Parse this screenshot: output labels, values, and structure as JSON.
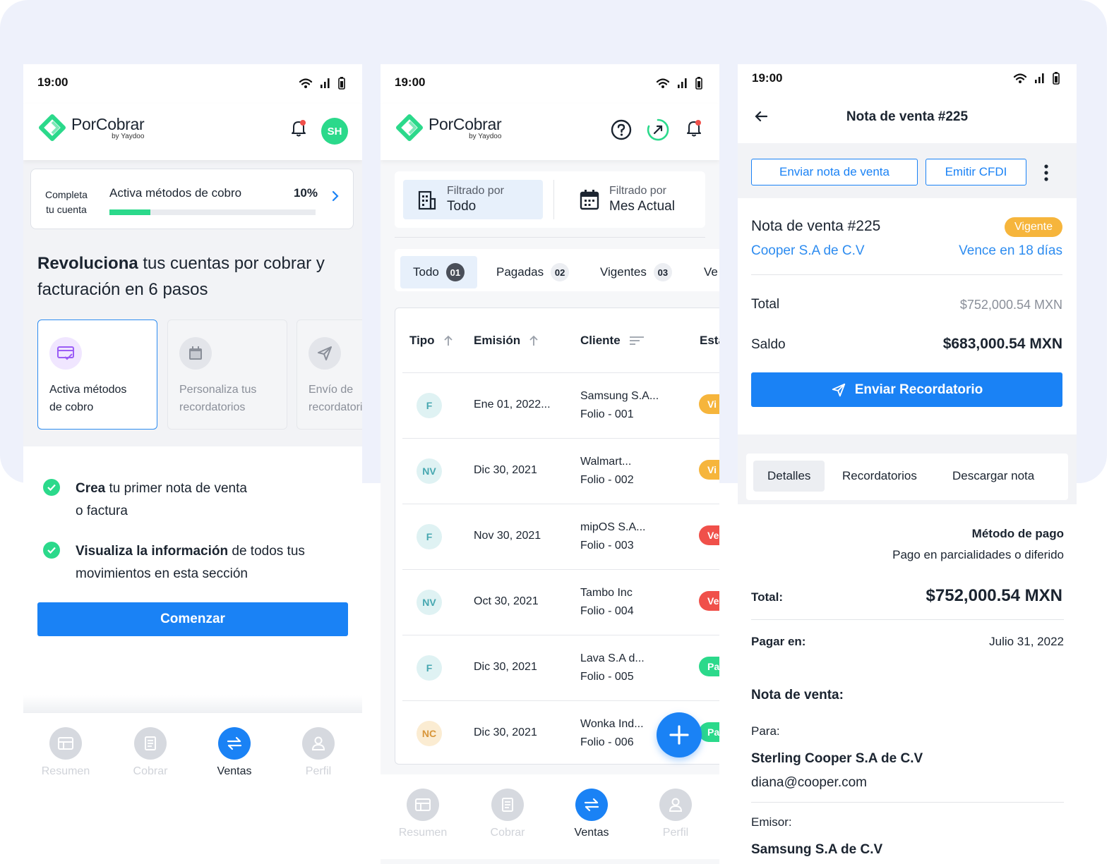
{
  "status": {
    "time": "19:00"
  },
  "brand": {
    "name": "PorCobrar",
    "by": "by Yaydoo"
  },
  "colors": {
    "primary": "#1a82f5",
    "green": "#2bd98b",
    "warning": "#f6b53c",
    "danger": "#f0504a"
  },
  "screen1": {
    "avatar": "SH",
    "progress": {
      "left_line1": "Completa",
      "left_line2": "tu cuenta",
      "title": "Activa métodos de cobro",
      "percent": "10%",
      "fraction": 0.2
    },
    "headline": {
      "bold": "Revoluciona",
      "rest": " tus cuentas por cobrar y facturación en 6 pasos"
    },
    "steps": [
      {
        "line1": "Activa métodos",
        "line2": "de cobro",
        "icon": "payment-card-icon"
      },
      {
        "line1": "Personaliza tus",
        "line2": "recordatorios",
        "icon": "calendar-icon"
      },
      {
        "line1": "Envío de",
        "line2": "recordatorios",
        "icon": "send-icon"
      }
    ],
    "checklist": [
      {
        "bold": "Crea",
        "line1": " tu primer nota de venta",
        "line2": "o factura"
      },
      {
        "bold": "Visualiza la información",
        "line1": " de todos tus",
        "line2": "movimientos en esta sección"
      }
    ],
    "cta": "Comenzar"
  },
  "nav": {
    "items": [
      "Resumen",
      "Cobrar",
      "Ventas",
      "Perfil"
    ],
    "active": "Ventas"
  },
  "screen2": {
    "filters": [
      {
        "sub": "Filtrado por",
        "value": "Todo"
      },
      {
        "sub": "Filtrado por",
        "value": "Mes Actual"
      }
    ],
    "tabs": [
      {
        "label": "Todo",
        "count": "01"
      },
      {
        "label": "Pagadas",
        "count": "02"
      },
      {
        "label": "Vigentes",
        "count": "03"
      },
      {
        "label": "Ve",
        "count": ""
      }
    ],
    "columns": [
      "Tipo",
      "Emisión",
      "Cliente",
      "Esta"
    ],
    "rows": [
      {
        "type": "F",
        "date": "Ene 01, 2022...",
        "client": "Samsung S.A...",
        "folio": "Folio - 001",
        "status": "Vi",
        "status_color": "#f6b53c",
        "badge_bg": "#dff2f3",
        "badge_fg": "#46a7b0"
      },
      {
        "type": "NV",
        "date": "Dic 30, 2021",
        "client": "Walmart...",
        "folio": "Folio - 002",
        "status": "Vi",
        "status_color": "#f6b53c",
        "badge_bg": "#dff2f3",
        "badge_fg": "#46a7b0"
      },
      {
        "type": "F",
        "date": "Nov 30, 2021",
        "client": "mipOS S.A...",
        "folio": "Folio - 003",
        "status": "Ve",
        "status_color": "#f0504a",
        "badge_bg": "#dff2f3",
        "badge_fg": "#46a7b0"
      },
      {
        "type": "NV",
        "date": "Oct 30, 2021",
        "client": "Tambo Inc",
        "folio": "Folio - 004",
        "status": "Ve",
        "status_color": "#f0504a",
        "badge_bg": "#dff2f3",
        "badge_fg": "#46a7b0"
      },
      {
        "type": "F",
        "date": "Dic 30, 2021",
        "client": "Lava S.A d...",
        "folio": "Folio - 005",
        "status": "Pa",
        "status_color": "#2bd98b",
        "badge_bg": "#dff2f3",
        "badge_fg": "#46a7b0"
      },
      {
        "type": "NC",
        "date": "Dic 30, 2021",
        "client": "Wonka Ind...",
        "folio": "Folio - 006",
        "status": "Pa",
        "status_color": "#2bd98b",
        "badge_bg": "#fbecd2",
        "badge_fg": "#d8963a"
      }
    ]
  },
  "screen3": {
    "title": "Nota de venta #225",
    "actions": {
      "send": "Enviar nota de venta",
      "cfdi": "Emitir CFDI"
    },
    "summary": {
      "title": "Nota de venta #225",
      "badge": "Vigente",
      "client": "Cooper S.A de C.V",
      "due": "Vence en 18 días",
      "total_label": "Total",
      "total_value": "$752,000.54 MXN",
      "saldo_label": "Saldo",
      "saldo_value": "$683,000.54 MXN",
      "reminder_button": "Enviar Recordatorio"
    },
    "tabs": [
      "Detalles",
      "Recordatorios",
      "Descargar nota"
    ],
    "details": {
      "metodo_label": "Método de pago",
      "metodo_value": "Pago en parcialidades o diferido",
      "total_label": "Total:",
      "total_value": "$752,000.54 MXN",
      "pagar_label": "Pagar en:",
      "pagar_value": "Julio 31, 2022",
      "nota_label": "Nota de venta:",
      "para_label": "Para:",
      "para_name": "Sterling Cooper S.A de C.V",
      "para_email": "diana@cooper.com",
      "emisor_label": "Emisor:",
      "emisor_name": "Samsung S.A de C.V"
    }
  }
}
